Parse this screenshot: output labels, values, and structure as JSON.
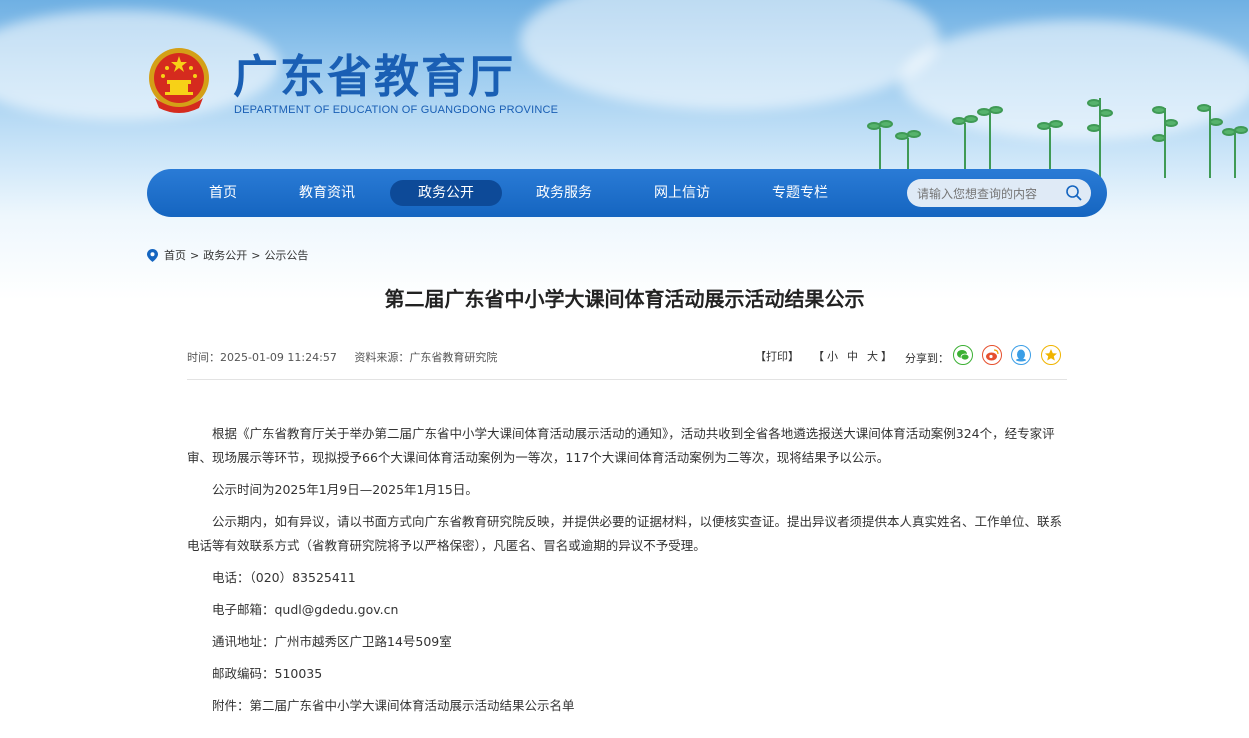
{
  "site": {
    "title": "广东省教育厅",
    "subtitle": "DEPARTMENT OF EDUCATION OF GUANGDONG PROVINCE"
  },
  "nav": {
    "items": [
      {
        "label": "首页"
      },
      {
        "label": "教育资讯"
      },
      {
        "label": "政务公开",
        "active": true
      },
      {
        "label": "政务服务"
      },
      {
        "label": "网上信访"
      },
      {
        "label": "专题专栏"
      }
    ],
    "search_placeholder": "请输入您想查询的内容"
  },
  "breadcrumb": {
    "items": [
      "首页",
      "政务公开",
      "公示公告"
    ],
    "separator": ">"
  },
  "article": {
    "title": "第二届广东省中小学大课间体育活动展示活动结果公示",
    "time": "时间：2025-01-09 11:24:57",
    "source": "资料来源：广东省教育研究院",
    "print": "【打印】",
    "size_open": "【",
    "size_small": "小",
    "size_mid": "中",
    "size_large": "大",
    "size_close": "】",
    "share_label": "分享到：",
    "paragraphs": [
      "根据《广东省教育厅关于举办第二届广东省中小学大课间体育活动展示活动的通知》，活动共收到全省各地遴选报送大课间体育活动案例324个，经专家评审、现场展示等环节，现拟授予66个大课间体育活动案例为一等次，117个大课间体育活动案例为二等次，现将结果予以公示。",
      "公示时间为2025年1月9日—2025年1月15日。",
      "公示期内，如有异议，请以书面方式向广东省教育研究院反映，并提供必要的证据材料，以便核实查证。提出异议者须提供本人真实姓名、工作单位、联系电话等有效联系方式（省教育研究院将予以严格保密），凡匿名、冒名或逾期的异议不予受理。"
    ],
    "contact": {
      "phone": "电话：（020）83525411",
      "email": "电子邮箱：qudl@gdedu.gov.cn",
      "address": "通讯地址：广州市越秀区广卫路14号509室",
      "postcode": "邮政编码：510035",
      "attachment": "附件：第二届广东省中小学大课间体育活动展示活动结果公示名单"
    }
  },
  "colors": {
    "brand_blue": "#1a5fb4",
    "nav_bg": "#1565c0",
    "nav_active": "#0d4a98",
    "share_wechat": "#3cb034",
    "share_weibo": "#e6502e",
    "share_qq": "#3b9ee6",
    "share_qzone": "#f0b400"
  },
  "icons": [
    "national-emblem-icon",
    "search-icon",
    "location-pin-icon",
    "wechat-icon",
    "weibo-icon",
    "qq-icon",
    "qzone-star-icon"
  ]
}
